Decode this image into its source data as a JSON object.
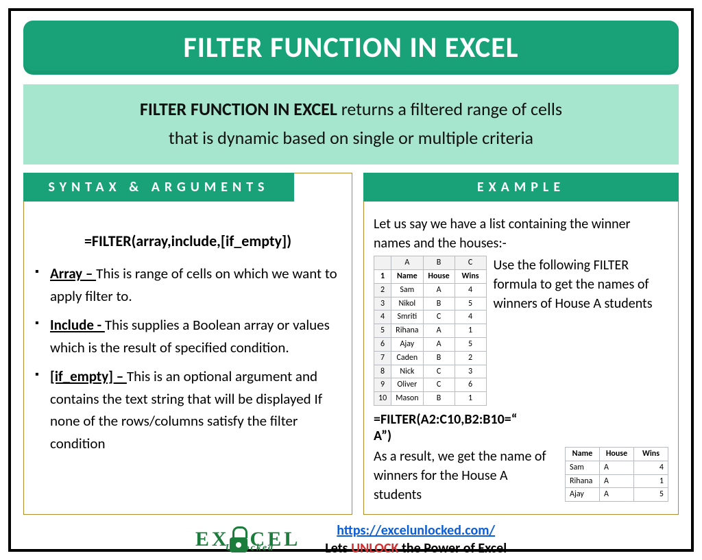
{
  "title": "FILTER FUNCTION IN EXCEL",
  "intro": {
    "strong": "FILTER FUNCTION IN EXCEL",
    "line1_rest": " returns a filtered range of cells",
    "line2": "that is dynamic based on single or multiple criteria"
  },
  "panels": {
    "syntax_tab": "SYNTAX & ARGUMENTS",
    "example_tab": "EXAMPLE"
  },
  "syntax": {
    "formula": "=FILTER(array,include,[if_empty])",
    "args": [
      {
        "name": "Array – ",
        "desc": "This is range of cells on which we want to apply filter to."
      },
      {
        "name": "Include -  ",
        "desc": "This supplies a Boolean array or values which is the result of specified condition."
      },
      {
        "name": "[if_empty] – ",
        "desc": "This is an optional argument and contains the text string that will be displayed If none of the rows/columns satisfy the filter condition"
      }
    ]
  },
  "example": {
    "lead": "Let us say we have a list containing the winner names and the houses:-",
    "side_text": "Use the following FILTER formula to get the names of winners of House A students",
    "sheet": {
      "col_letters": [
        "A",
        "B",
        "C"
      ],
      "headers": [
        "Name",
        "House",
        "Wins"
      ],
      "rows": [
        {
          "n": "2",
          "c": [
            "Sam",
            "A",
            "4"
          ]
        },
        {
          "n": "3",
          "c": [
            "Nikol",
            "B",
            "5"
          ]
        },
        {
          "n": "4",
          "c": [
            "Smriti",
            "C",
            "4"
          ]
        },
        {
          "n": "5",
          "c": [
            "Rihana",
            "A",
            "1"
          ]
        },
        {
          "n": "6",
          "c": [
            "Ajay",
            "A",
            "5"
          ]
        },
        {
          "n": "7",
          "c": [
            "Caden",
            "B",
            "2"
          ]
        },
        {
          "n": "8",
          "c": [
            "Nick",
            "C",
            "3"
          ]
        },
        {
          "n": "9",
          "c": [
            "Oliver",
            "C",
            "6"
          ]
        },
        {
          "n": "10",
          "c": [
            "Mason",
            "B",
            "1"
          ]
        }
      ]
    },
    "formula_line1": "=FILTER(A2:C10,B2:B10=“",
    "formula_line2": "A”)",
    "result_text": "As a result, we get the name of winners for the House A students",
    "result": {
      "headers": [
        "Name",
        "House",
        "Wins"
      ],
      "rows": [
        [
          "Sam",
          "A",
          "4"
        ],
        [
          "Rihana",
          "A",
          "1"
        ],
        [
          "Ajay",
          "A",
          "5"
        ]
      ]
    }
  },
  "footer": {
    "logo_top": "EXCEL",
    "logo_sub": "Unlocked",
    "url": "https://excelunlocked.com/",
    "tag_pre": "Lets ",
    "tag_mid": "UNLOCK",
    "tag_post": " the Power of Excel"
  }
}
